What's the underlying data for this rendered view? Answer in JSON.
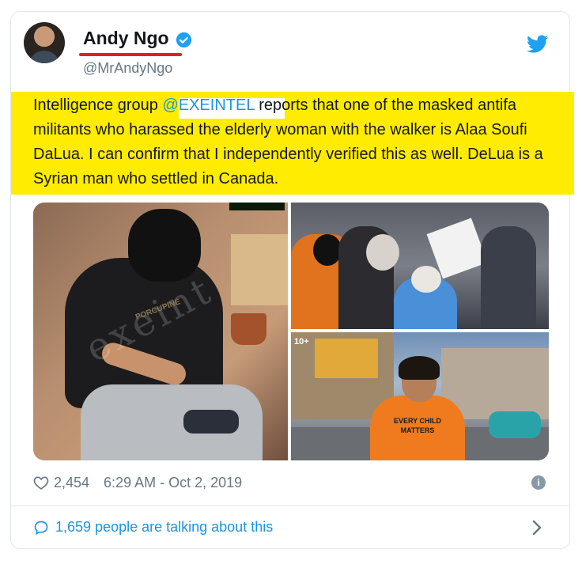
{
  "tweet": {
    "author": {
      "display_name": "Andy Ngo",
      "handle": "@MrAndyNgo",
      "verified": true
    },
    "text": {
      "segment_1": "Intelligence group ",
      "mention": "@EXEINTEL",
      "segment_2": " reports that one of the masked antifa militants who harassed the elderly woman with the walker is Alaa Soufi DaLua. I can confirm that I independently verified this as well. DeLua is a Syrian man who settled in Canada."
    },
    "media": {
      "photo_1_watermark": "exeint",
      "photo_1_shirt_text": "PORCUPINE",
      "photo_3_badge": "10+",
      "photo_3_shirt_text": "EVERY CHILD MATTERS"
    },
    "likes": "2,454",
    "timestamp": "6:29 AM - Oct 2, 2019",
    "conversation": "1,659 people are talking about this"
  },
  "colors": {
    "highlight": "#ffec00",
    "link": "#1b95e0",
    "underline": "#e0201e",
    "secondary_text": "#657786"
  },
  "icons": [
    "verified-badge-icon",
    "twitter-bird-icon",
    "heart-icon",
    "info-icon",
    "speech-bubble-icon",
    "chevron-right-icon"
  ]
}
